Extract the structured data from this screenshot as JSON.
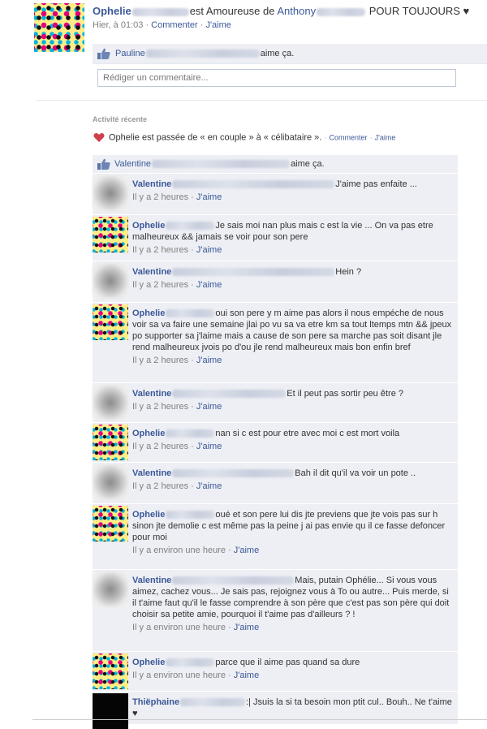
{
  "status": {
    "author": "Ophelie",
    "text": "est Amoureuse de",
    "tagged": "Anthony",
    "suffix": "POUR TOUJOURS ♥",
    "time": "Hier, à 01:03",
    "sep": "·",
    "comment_link": "Commenter",
    "like_link": "J'aime",
    "likes_name": "Pauline",
    "likes_suffix": "aime ça.",
    "comment_placeholder": "Rédiger un commentaire..."
  },
  "activity": {
    "label": "Activité récente",
    "text": "Ophelie est passée de « en couple » à « célibataire ».",
    "comment_link": "Commenter",
    "like_link": "J'aime",
    "likes_name": "Valentine",
    "likes_suffix": "aime ça."
  },
  "comments": [
    {
      "author": "Valentine",
      "avatar": "blur",
      "blurw": 200,
      "text": "J'aime pas enfaite ...",
      "time": "Il y a 2 heures",
      "like": "J'aime"
    },
    {
      "author": "Ophelie",
      "avatar": "dots",
      "blurw": 60,
      "text": "Je sais moi nan plus mais c est la vie ... On va pas etre malheureux && jamais se voir pour son pere",
      "time": "Il y a 2 heures",
      "like": "J'aime"
    },
    {
      "author": "Valentine",
      "avatar": "blur",
      "blurw": 200,
      "text": "Hein ?",
      "time": "Il y a 2 heures",
      "like": "J'aime"
    },
    {
      "author": "Ophelie",
      "avatar": "dots",
      "blurw": 60,
      "text": "oui son pere y m aime pas alors il nous empéche de nous voir sa va faire une semaine jlai po vu sa va etre km sa tout ltemps mtn && jpeux po supporter sa j'laime mais a cause de son pere sa marche pas soit disant jle rend malheureux jvois po d'ou jle rend malheureux mais bon enfin bref",
      "time": "Il y a 2 heures",
      "like": "J'aime"
    },
    {
      "author": "Valentine",
      "avatar": "blur",
      "blurw": 140,
      "text": "Et il peut pas sortir peu être ?",
      "time": "Il y a 2 heures",
      "like": "J'aime"
    },
    {
      "author": "Ophelie",
      "avatar": "dots",
      "blurw": 60,
      "text": "nan si c est pour etre avec moi c est mort voila",
      "time": "Il y a 2 heures",
      "like": "J'aime"
    },
    {
      "author": "Valentine",
      "avatar": "blur",
      "blurw": 150,
      "text": "Bah il dit qu'il va voir un pote ..",
      "time": "Il y a 2 heures",
      "like": "J'aime"
    },
    {
      "author": "Ophelie",
      "avatar": "dots",
      "blurw": 60,
      "text": "oué et son pere lui dis jte previens que jte vois pas sur h sinon jte demolie c est même pas la peine j ai pas envie qu il ce fasse defoncer pour moi",
      "time": "Il y a environ une heure",
      "like": "J'aime"
    },
    {
      "author": "Valentine",
      "avatar": "blur",
      "blurw": 150,
      "text": "Mais, putain Ophélie... Si vous vous aimez, cachez vous... Je sais pas, rejoignez vous à To ou autre... Puis merde, si il t'aime faut qu'il le fasse comprendre à son père que c'est pas son père qui doit choisir sa petite amie, pourquoi il t'aime pas d'ailleurs ? !",
      "time": "Il y a environ une heure",
      "like": "J'aime"
    },
    {
      "author": "Ophelie",
      "avatar": "dots",
      "blurw": 60,
      "text": "parce que il aime pas quand sa dure",
      "time": "Il y a environ une heure",
      "like": "J'aime"
    },
    {
      "author": "Thiëphaine",
      "avatar": "black",
      "blurw": 80,
      "text": ":| Jsuis la si ta besoin mon ptit cul.. Bouh.. Ne t'aime ♥",
      "time": "",
      "like": ""
    }
  ],
  "colors": {
    "link": "#3b5998",
    "panel": "#edeff4",
    "heart": "#d0404a"
  }
}
